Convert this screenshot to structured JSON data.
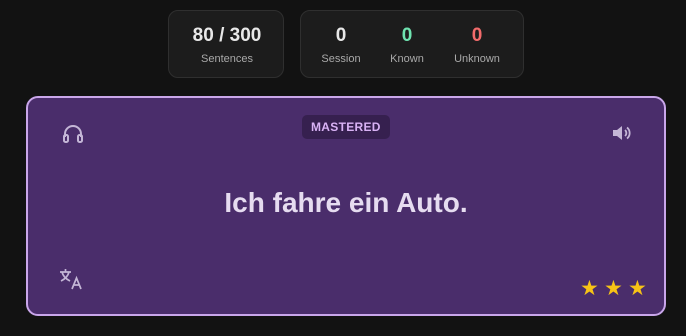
{
  "stats": {
    "sentences": {
      "value": "80 / 300",
      "label": "Sentences"
    },
    "session": {
      "value": "0",
      "label": "Session"
    },
    "known": {
      "value": "0",
      "label": "Known",
      "color": "#6fe3b0"
    },
    "unknown": {
      "value": "0",
      "label": "Unknown",
      "color": "#f26b6b"
    }
  },
  "card": {
    "status_badge": "MASTERED",
    "sentence": "Ich fahre ein Auto.",
    "rating": {
      "stars": 3,
      "max": 3
    },
    "icons": {
      "headphones": "headphones-icon",
      "speaker": "speaker-icon",
      "translate": "translate-icon",
      "star": "star-icon"
    },
    "colors": {
      "background": "#4a2d6b",
      "border": "#c9a6ea",
      "star": "#f7c316"
    }
  }
}
